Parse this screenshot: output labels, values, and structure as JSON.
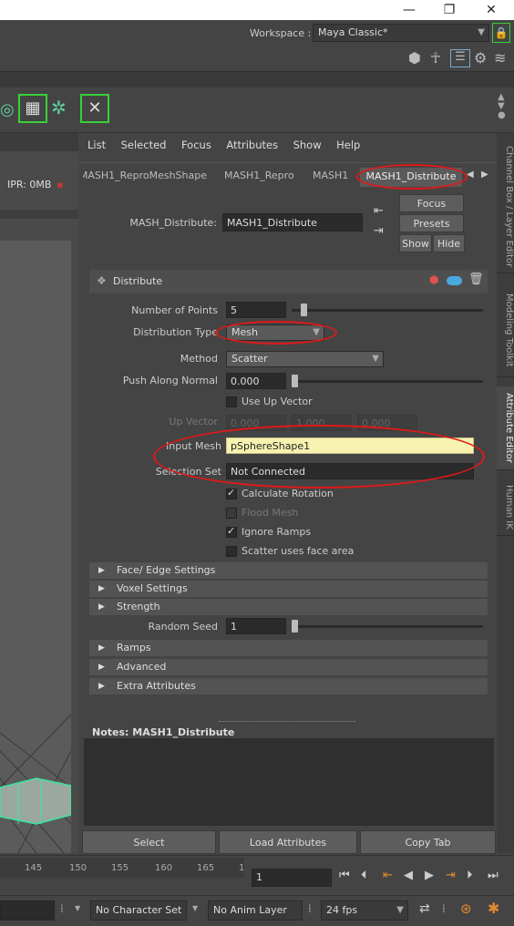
{
  "window": {
    "minimize": "—",
    "maximize": "❐",
    "close": "✕"
  },
  "top": {
    "workspace_label": "Workspace :",
    "workspace_value": "Maya Classic*"
  },
  "viewport": {
    "ipr": "IPR: 0MB"
  },
  "ae": {
    "menu": [
      "List",
      "Selected",
      "Focus",
      "Attributes",
      "Show",
      "Help"
    ],
    "node_tabs": [
      "MASH1_ReproMeshShape",
      "MASH1_Repro",
      "MASH1",
      "MASH1_Distribute"
    ],
    "node_label": "MASH_Distribute:",
    "node_name": "MASH1_Distribute",
    "buttons": {
      "focus": "Focus",
      "presets": "Presets",
      "show": "Show",
      "hide": "Hide"
    },
    "section_title": "Distribute",
    "fields": {
      "num_points_label": "Number of Points",
      "num_points": "5",
      "dist_type_label": "Distribution Type",
      "dist_type": "Mesh",
      "method_label": "Method",
      "method": "Scatter",
      "push_label": "Push Along Normal",
      "push": "0.000",
      "use_up_vector": "Use Up Vector",
      "up_vector_label": "Up Vector",
      "up_x": "0.000",
      "up_y": "1.000",
      "up_z": "0.000",
      "input_mesh_label": "Input Mesh",
      "input_mesh": "pSphereShape1",
      "selection_set_label": "Selection Set",
      "selection_set": "Not Connected",
      "calc_rotation": "Calculate Rotation",
      "flood_mesh": "Flood Mesh",
      "ignore_ramps": "Ignore Ramps",
      "scatter_face_area": "Scatter uses face area",
      "random_seed_label": "Random Seed",
      "random_seed": "1"
    },
    "frames": [
      "Face/ Edge Settings",
      "Voxel Settings",
      "Strength",
      "Ramps",
      "Advanced",
      "Extra Attributes"
    ],
    "notes_label": "Notes:  MASH1_Distribute",
    "bottom_buttons": [
      "Select",
      "Load Attributes",
      "Copy Tab"
    ]
  },
  "right_tabs": [
    "Channel Box / Layer Editor",
    "Modeling Toolkit",
    "Attribute Editor",
    "Human IK"
  ],
  "timeline": {
    "ticks": [
      "145",
      "150",
      "155",
      "160",
      "165",
      "1"
    ],
    "current_frame": "1"
  },
  "bottom": {
    "char_set": "No Character Set",
    "anim_layer": "No Anim Layer",
    "fps": "24 fps"
  }
}
